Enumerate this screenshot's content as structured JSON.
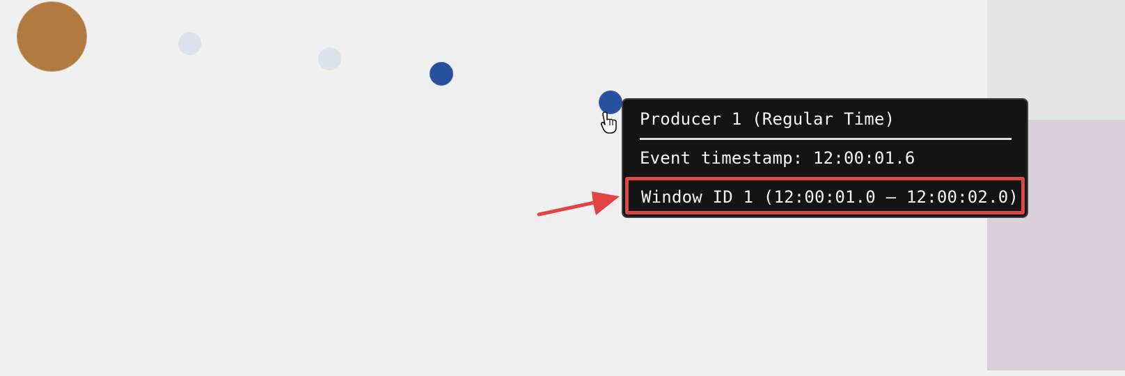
{
  "tooltip": {
    "title": "Producer 1 (Regular Time)",
    "timestamp_label": "Event timestamp: 12:00:01.6",
    "window_label": "Window ID 1 (12:00:01.0 – 12:00:02.0)"
  },
  "colors": {
    "background": "#f0f0f0",
    "producer": "#b07a40",
    "faded_event": "#dde3ea",
    "event": "#27509e",
    "tooltip_bg": "#141414",
    "highlight": "#d84848",
    "window_panel": "#dccfdc",
    "side_panel": "#e5e5e5"
  },
  "icons": {
    "cursor": "hand-pointer-cursor",
    "annotation": "red-arrow"
  }
}
